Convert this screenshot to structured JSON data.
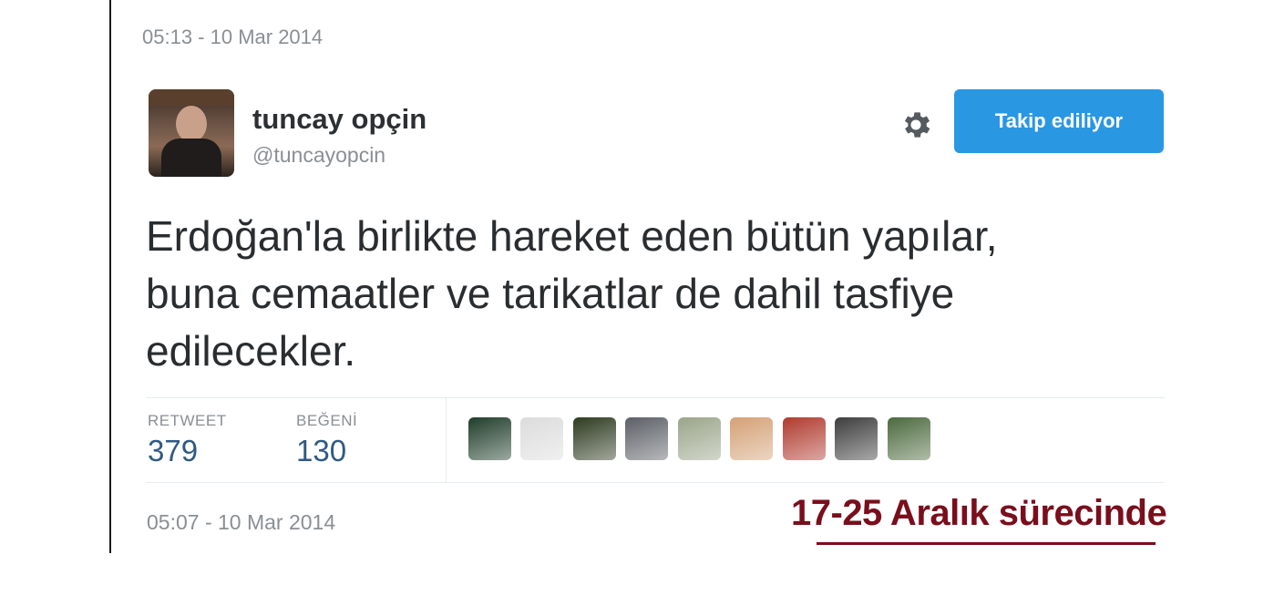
{
  "header": {
    "timestamp": "05:13 - 10 Mar 2014"
  },
  "user": {
    "display_name": "tuncay opçin",
    "handle": "@tuncayopcin"
  },
  "actions": {
    "follow_label": "Takip ediliyor",
    "settings_icon": "gear-icon"
  },
  "tweet": {
    "lines": [
      "Erdoğan'la birlikte hareket eden bütün yapılar,",
      "buna cemaatler ve tarikatlar de dahil tasfiye",
      "edilecekler."
    ]
  },
  "stats": {
    "retweet_label": "RETWEET",
    "retweet_count": "379",
    "like_label": "BEĞENİ",
    "like_count": "130"
  },
  "likers": [
    {
      "name": "liker-avatar-1",
      "color": "#1f3d2a"
    },
    {
      "name": "liker-avatar-2",
      "color": "#dcdcdc"
    },
    {
      "name": "liker-avatar-3",
      "color": "#2d3a1f"
    },
    {
      "name": "liker-avatar-4",
      "color": "#5b5f66"
    },
    {
      "name": "liker-avatar-5",
      "color": "#9aa58a"
    },
    {
      "name": "liker-avatar-6",
      "color": "#d4a176"
    },
    {
      "name": "liker-avatar-7",
      "color": "#b03a2e"
    },
    {
      "name": "liker-avatar-8",
      "color": "#3d3d3d"
    },
    {
      "name": "liker-avatar-9",
      "color": "#4c6a3e"
    }
  ],
  "footer": {
    "timestamp": "05:07 - 10 Mar 2014",
    "caption": "17-25 Aralık sürecinde"
  },
  "colors": {
    "accent": "#2a97e3",
    "caption": "#7a0e1c",
    "stat_value": "#2f5a82"
  }
}
